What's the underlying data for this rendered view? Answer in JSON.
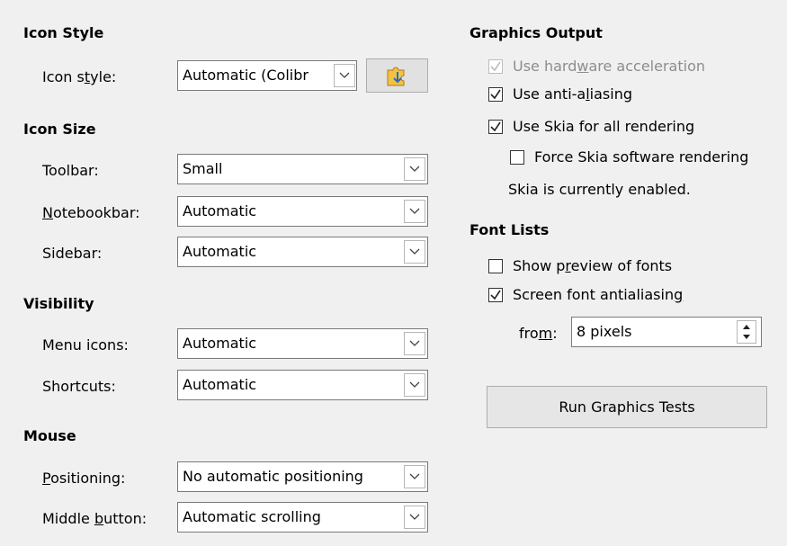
{
  "left": {
    "icon_style": {
      "heading": "Icon Style",
      "label_pre": "Icon s",
      "label_u": "t",
      "label_post": "yle:",
      "value": "Automatic (Colibr",
      "icon": "puzzle-extension-icon"
    },
    "icon_size": {
      "heading": "Icon Size",
      "toolbar_label": "Toolbar:",
      "toolbar_value": "Small",
      "notebookbar_label_u": "N",
      "notebookbar_label_post": "otebookbar:",
      "notebookbar_value": "Automatic",
      "sidebar_label": "Sidebar:",
      "sidebar_value": "Automatic"
    },
    "visibility": {
      "heading": "Visibility",
      "menu_icons_label": "Menu icons:",
      "menu_icons_value": "Automatic",
      "shortcuts_label": "Shortcuts:",
      "shortcuts_value": "Automatic"
    },
    "mouse": {
      "heading": "Mouse",
      "positioning_label_u": "P",
      "positioning_label_post": "ositioning:",
      "positioning_value": "No automatic positioning",
      "middle_label_pre": "Middle ",
      "middle_label_u": "b",
      "middle_label_post": "utton:",
      "middle_value": "Automatic scrolling"
    }
  },
  "right": {
    "graphics": {
      "heading": "Graphics Output",
      "hw_pre": "Use hard",
      "hw_u": "w",
      "hw_post": "are acceleration",
      "hw_checked": true,
      "hw_disabled": true,
      "aa_pre": "Use anti-a",
      "aa_u": "l",
      "aa_post": "iasing",
      "aa_checked": true,
      "skia_label": "Use Skia for all rendering",
      "skia_checked": true,
      "force_label": "Force Skia software rendering",
      "force_checked": false,
      "status": "Skia is currently enabled."
    },
    "fonts": {
      "heading": "Font Lists",
      "preview_pre": "Show p",
      "preview_u": "r",
      "preview_post": "eview of fonts",
      "preview_checked": false,
      "screen_pre": "Screen font antialiasin",
      "screen_u": "g",
      "screen_checked": true,
      "from_pre": "fro",
      "from_u": "m",
      "from_post": ":",
      "from_value": "8 pixels"
    },
    "run_tests_button": "Run Graphics Tests"
  }
}
